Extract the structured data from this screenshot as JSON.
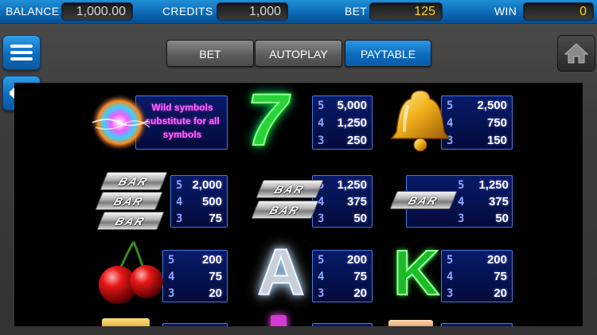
{
  "topbar": {
    "balance_label": "BALANCE",
    "balance_value": "1,000.00",
    "credits_label": "CREDITS",
    "credits_value": "1,000",
    "bet_label": "BET",
    "bet_value": "125",
    "win_label": "WIN",
    "win_value": "0"
  },
  "tabs": [
    {
      "label": "BET",
      "active": false
    },
    {
      "label": "AUTOPLAY",
      "active": false
    },
    {
      "label": "PAYTABLE",
      "active": true
    }
  ],
  "buttons": {
    "menu_icon": "hamburger-icon",
    "back_icon": "arrow-left-icon",
    "home_icon": "home-icon"
  },
  "paytable": {
    "wild_text": "Wild symbols substitute for all symbols",
    "symbols": [
      {
        "name": "seven",
        "pays": [
          {
            "count": "5",
            "value": "5,000"
          },
          {
            "count": "4",
            "value": "1,250"
          },
          {
            "count": "3",
            "value": "250"
          }
        ]
      },
      {
        "name": "bell",
        "pays": [
          {
            "count": "5",
            "value": "2,500"
          },
          {
            "count": "4",
            "value": "750"
          },
          {
            "count": "3",
            "value": "150"
          }
        ]
      },
      {
        "name": "triple-bar",
        "pays": [
          {
            "count": "5",
            "value": "2,000"
          },
          {
            "count": "4",
            "value": "500"
          },
          {
            "count": "3",
            "value": "75"
          }
        ]
      },
      {
        "name": "double-bar",
        "pays": [
          {
            "count": "5",
            "value": "1,250"
          },
          {
            "count": "4",
            "value": "375"
          },
          {
            "count": "3",
            "value": "50"
          }
        ]
      },
      {
        "name": "single-bar",
        "pays": [
          {
            "count": "5",
            "value": "1,250"
          },
          {
            "count": "4",
            "value": "375"
          },
          {
            "count": "3",
            "value": "50"
          }
        ]
      },
      {
        "name": "cherry",
        "pays": [
          {
            "count": "5",
            "value": "200"
          },
          {
            "count": "4",
            "value": "75"
          },
          {
            "count": "3",
            "value": "20"
          }
        ]
      },
      {
        "name": "letter-a",
        "pays": [
          {
            "count": "5",
            "value": "200"
          },
          {
            "count": "4",
            "value": "75"
          },
          {
            "count": "3",
            "value": "20"
          }
        ]
      },
      {
        "name": "letter-k",
        "pays": [
          {
            "count": "5",
            "value": "200"
          },
          {
            "count": "4",
            "value": "75"
          },
          {
            "count": "3",
            "value": "20"
          }
        ]
      }
    ],
    "bar_word": "BAR",
    "letter_a": "A",
    "letter_k": "K",
    "seven_glyph": "7"
  },
  "colors": {
    "accent_blue": "#0c6bbf",
    "bet_yellow": "#ffd21c",
    "wild_pink": "#ff6cff",
    "panel_border": "#3f7ee0"
  }
}
